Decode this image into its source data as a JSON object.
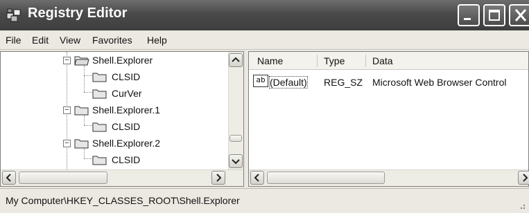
{
  "window": {
    "title": "Registry Editor"
  },
  "icons": {
    "app": "registry-editor-icon",
    "minimize": "minimize-icon",
    "maximize": "maximize-icon",
    "close": "close-icon",
    "folder": "folder-icon",
    "string_value": "string-value-icon"
  },
  "menu": [
    "File",
    "Edit",
    "View",
    "Favorites",
    "Help"
  ],
  "tree": [
    {
      "label": "Shell.Explorer",
      "expanded": true,
      "open_folder": true
    },
    {
      "label": "CLSID"
    },
    {
      "label": "CurVer"
    },
    {
      "label": "Shell.Explorer.1",
      "expanded": true
    },
    {
      "label": "CLSID"
    },
    {
      "label": "Shell.Explorer.2",
      "expanded": true
    },
    {
      "label": "CLSID"
    }
  ],
  "list": {
    "columns": [
      "Name",
      "Type",
      "Data"
    ],
    "rows": [
      {
        "icon_text": "ab",
        "name": "(Default)",
        "type": "REG_SZ",
        "data": "Microsoft Web Browser Control"
      }
    ]
  },
  "status": {
    "path": "My Computer\\HKEY_CLASSES_ROOT\\Shell.Explorer"
  }
}
